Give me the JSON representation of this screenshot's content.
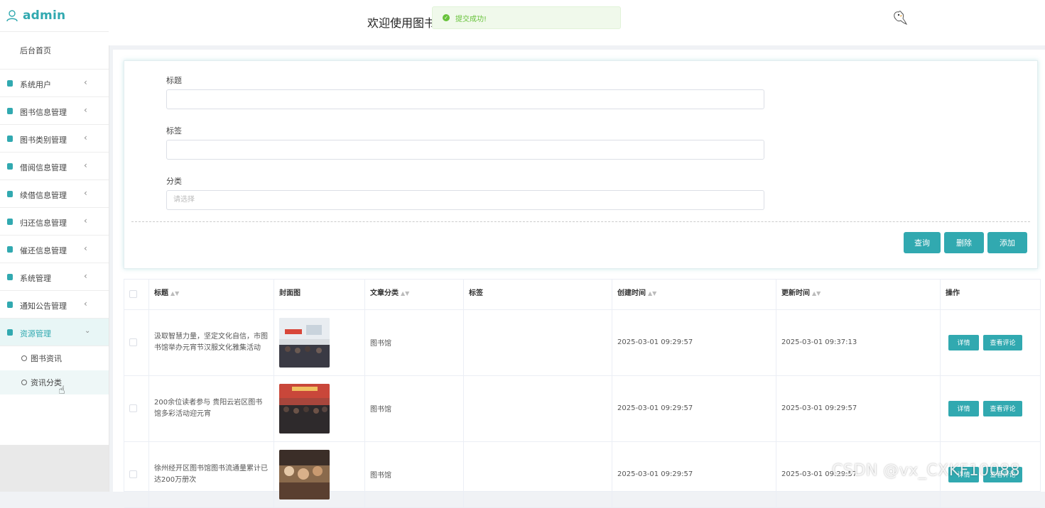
{
  "sidebar": {
    "brand": "admin",
    "home": "后台首页",
    "items": [
      {
        "label": "系统用户"
      },
      {
        "label": "图书信息管理"
      },
      {
        "label": "图书类别管理"
      },
      {
        "label": "借阅信息管理"
      },
      {
        "label": "续借信息管理"
      },
      {
        "label": "归还信息管理"
      },
      {
        "label": "催还信息管理"
      },
      {
        "label": "系统管理"
      },
      {
        "label": "通知公告管理"
      },
      {
        "label": "资源管理"
      }
    ],
    "subitems": [
      {
        "label": "图书资讯"
      },
      {
        "label": "资讯分类"
      }
    ]
  },
  "header": {
    "welcome": "欢迎使用图书",
    "toast": "提交成功!"
  },
  "search": {
    "title_label": "标题",
    "tag_label": "标签",
    "category_label": "分类",
    "category_placeholder": "请选择",
    "query_button": "查询",
    "delete_button": "删除",
    "add_button": "添加"
  },
  "table": {
    "columns": [
      "标题",
      "封面图",
      "文章分类",
      "标签",
      "创建时间",
      "更新时间",
      "操作"
    ],
    "rows": [
      {
        "title": "汲取智慧力量，坚定文化自信，市图书馆举办元宵节汉服文化雅集活动",
        "category": "图书馆",
        "tag": "",
        "created": "2025-03-01 09:29:57",
        "updated": "2025-03-01 09:37:13"
      },
      {
        "title": "200余位读者参与 贵阳云岩区图书馆多彩活动迎元宵",
        "category": "图书馆",
        "tag": "",
        "created": "2025-03-01 09:29:57",
        "updated": "2025-03-01 09:29:57"
      },
      {
        "title": "徐州经开区图书馆图书流通量累计已达200万册次",
        "category": "图书馆",
        "tag": "",
        "created": "2025-03-01 09:29:57",
        "updated": "2025-03-01 09:29:57"
      }
    ],
    "detail_button": "详情",
    "comment_button": "查看评论"
  },
  "watermark": "CSDN @vx_CXKF10088",
  "colors": {
    "accent": "#31a9b0",
    "success": "#67c23a"
  }
}
